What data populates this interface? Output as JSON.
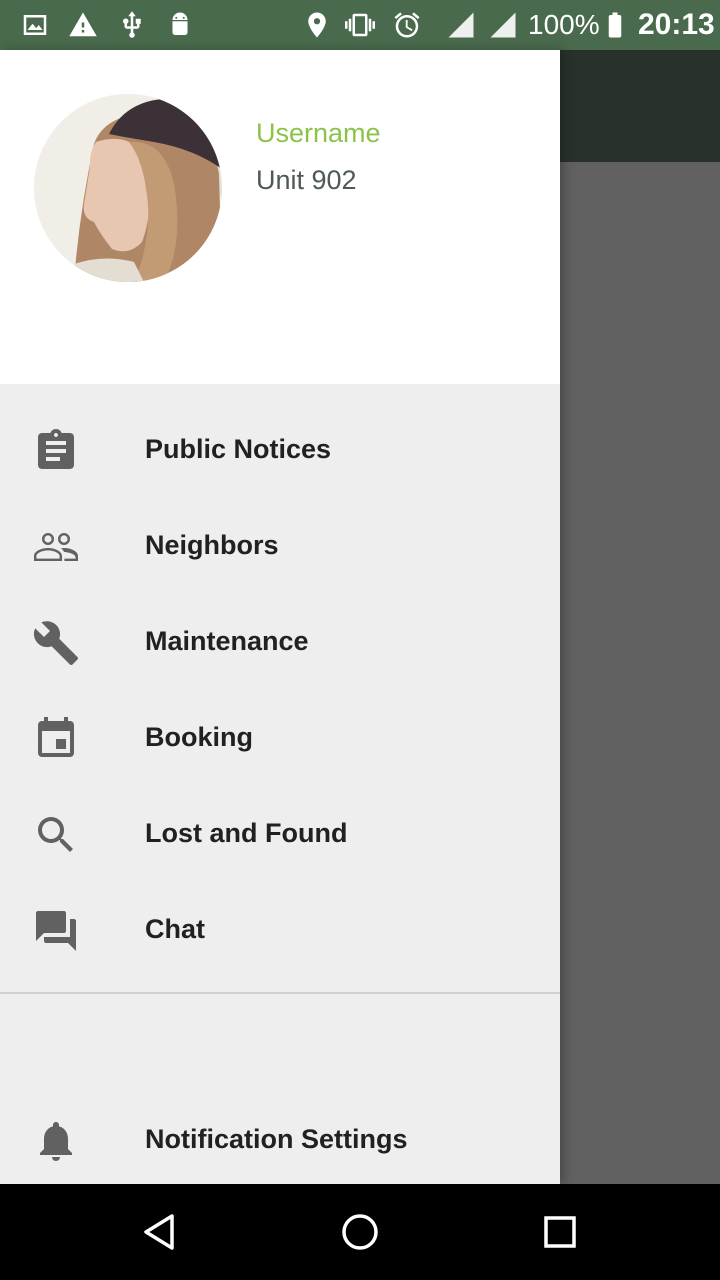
{
  "status_bar": {
    "battery_percent": "100%",
    "time": "20:13",
    "icons": [
      "image-icon",
      "warning-icon",
      "usb-icon",
      "android-icon",
      "location-icon",
      "vibrate-icon",
      "alarm-icon",
      "signal-hplus-icon",
      "signal-g-icon",
      "battery-icon"
    ]
  },
  "drawer": {
    "header": {
      "username": "Username",
      "unit": "Unit 902"
    },
    "items": [
      {
        "label": "Public Notices",
        "icon": "clipboard-icon"
      },
      {
        "label": "Neighbors",
        "icon": "people-icon"
      },
      {
        "label": "Maintenance",
        "icon": "wrench-icon"
      },
      {
        "label": "Booking",
        "icon": "calendar-icon"
      },
      {
        "label": "Lost and Found",
        "icon": "search-icon"
      },
      {
        "label": "Chat",
        "icon": "chat-icon"
      }
    ],
    "settings": {
      "label": "Notification Settings",
      "icon": "bell-icon"
    }
  },
  "colors": {
    "status_bar": "#4a6a4d",
    "toolbar": "#28322a",
    "accent": "#8bc34a",
    "scrim": "#616161"
  },
  "nav_bar": {
    "icons": [
      "back-icon",
      "home-icon",
      "recents-icon"
    ]
  }
}
